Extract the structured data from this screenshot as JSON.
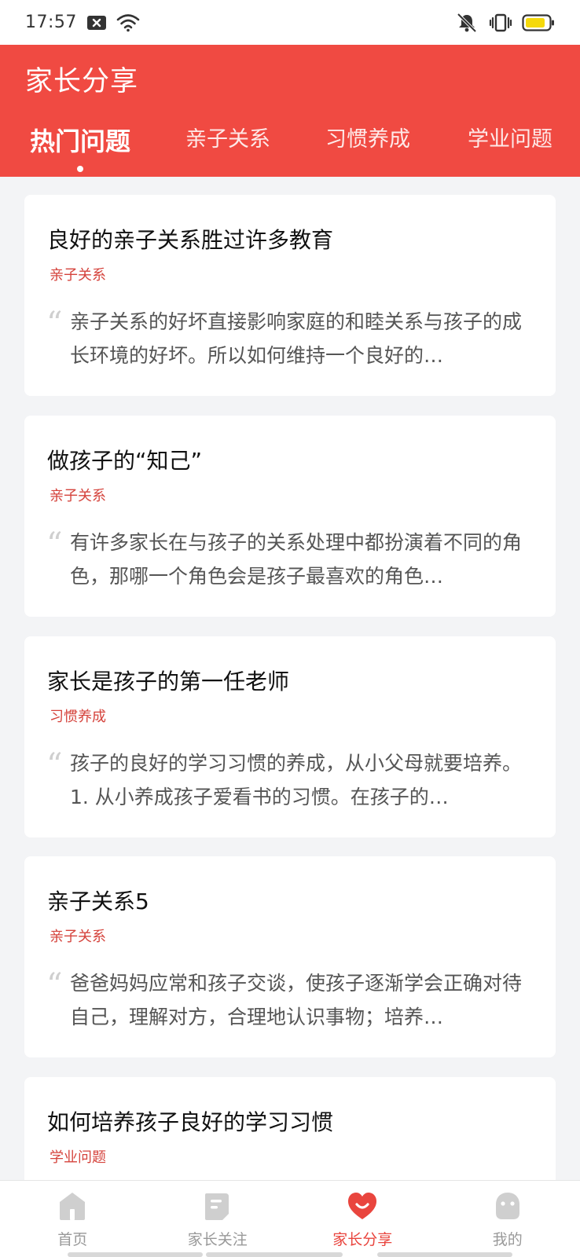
{
  "status_bar": {
    "time": "17:57",
    "icons": [
      "notification-x-icon",
      "wifi-icon",
      "vibrate-mute-icon",
      "vibrate-icon",
      "battery-icon"
    ],
    "battery_color": "#f5d90a"
  },
  "header": {
    "title": "家长分享",
    "background": "#f04a42",
    "tabs": [
      {
        "label": "热门问题",
        "active": true
      },
      {
        "label": "亲子关系",
        "active": false
      },
      {
        "label": "习惯养成",
        "active": false
      },
      {
        "label": "学业问题",
        "active": false
      }
    ]
  },
  "cards": [
    {
      "title": "良好的亲子关系胜过许多教育",
      "tag": "亲子关系",
      "excerpt": "亲子关系的好坏直接影响家庭的和睦关系与孩子的成长环境的好坏。所以如何维持一个良好的…"
    },
    {
      "title": "做孩子的“知己”",
      "tag": "亲子关系",
      "excerpt": "有许多家长在与孩子的关系处理中都扮演着不同的角色，那哪一个角色会是孩子最喜欢的角色…"
    },
    {
      "title": "家长是孩子的第一任老师",
      "tag": "习惯养成",
      "excerpt": "孩子的良好的学习习惯的养成，从小父母就要培养。 1. 从小养成孩子爱看书的习惯。在孩子的…"
    },
    {
      "title": "亲子关系5",
      "tag": "亲子关系",
      "excerpt": "爸爸妈妈应常和孩子交谈，使孩子逐渐学会正确对待自己，理解对方，合理地认识事物；培养…"
    },
    {
      "title": "如何培养孩子良好的学习习惯",
      "tag": "学业问题",
      "excerpt": ""
    }
  ],
  "bottom_nav": {
    "items": [
      {
        "label": "首页",
        "icon": "home-icon",
        "active": false
      },
      {
        "label": "家长关注",
        "icon": "document-icon",
        "active": false
      },
      {
        "label": "家长分享",
        "icon": "heart-smile-icon",
        "active": true
      },
      {
        "label": "我的",
        "icon": "profile-icon",
        "active": false
      }
    ],
    "active_color": "#e9453e",
    "inactive_color": "#999999"
  }
}
